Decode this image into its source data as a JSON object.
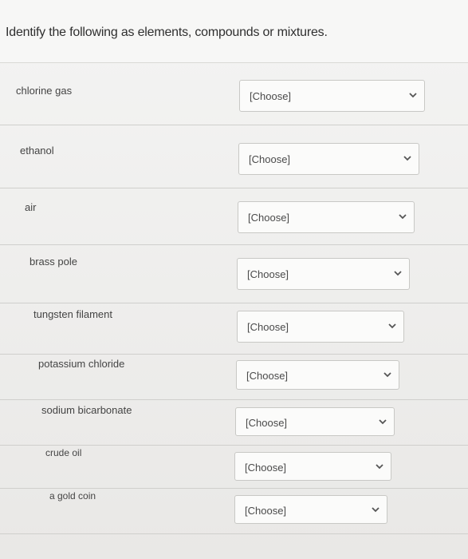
{
  "question": {
    "title": "Identify the following as elements, compounds or mixtures."
  },
  "items": [
    {
      "label": "chlorine gas",
      "selected": "[Choose]"
    },
    {
      "label": "ethanol",
      "selected": "[Choose]"
    },
    {
      "label": "air",
      "selected": "[Choose]"
    },
    {
      "label": "brass pole",
      "selected": "[Choose]"
    },
    {
      "label": "tungsten filament",
      "selected": "[Choose]"
    },
    {
      "label": "potassium chloride",
      "selected": "[Choose]"
    },
    {
      "label": "sodium bicarbonate",
      "selected": "[Choose]"
    },
    {
      "label": "crude oil",
      "selected": "[Choose]"
    },
    {
      "label": "a gold coin",
      "selected": "[Choose]"
    }
  ]
}
